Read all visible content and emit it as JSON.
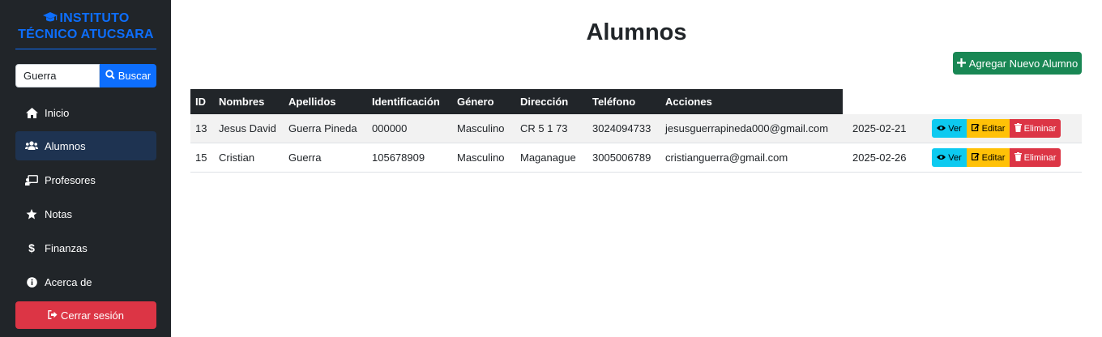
{
  "sidebar": {
    "brand_line1": "INSTITUTO",
    "brand_line2": "TÉCNICO ATUCSARA",
    "search": {
      "value": "Guerra",
      "button_label": "Buscar"
    },
    "items": [
      {
        "label": "Inicio",
        "icon": "home-icon"
      },
      {
        "label": "Alumnos",
        "icon": "users-icon",
        "active": true
      },
      {
        "label": "Profesores",
        "icon": "chalkboard-teacher-icon"
      },
      {
        "label": "Notas",
        "icon": "star-icon"
      },
      {
        "label": "Finanzas",
        "icon": "dollar-icon"
      },
      {
        "label": "Acerca de",
        "icon": "info-circle-icon"
      }
    ],
    "logout_label": "Cerrar sesión"
  },
  "main": {
    "title": "Alumnos",
    "add_button_label": "Agregar Nuevo Alumno",
    "table": {
      "headers": [
        "ID",
        "Nombres",
        "Apellidos",
        "Identificación",
        "Género",
        "Dirección",
        "Teléfono",
        "Acciones"
      ],
      "rows": [
        {
          "id": "13",
          "nombres": "Jesus David",
          "apellidos": "Guerra Pineda",
          "identificacion": "000000",
          "genero": "Masculino",
          "direccion": "CR 5 1 73",
          "telefono": "3024094733",
          "email": "jesusguerrapineda000@gmail.com",
          "fecha": "2025-02-21"
        },
        {
          "id": "15",
          "nombres": "Cristian",
          "apellidos": "Guerra",
          "identificacion": "105678909",
          "genero": "Masculino",
          "direccion": "Maganague",
          "telefono": "3005006789",
          "email": "cristianguerra@gmail.com",
          "fecha": "2025-02-26"
        }
      ],
      "actions": {
        "view": "Ver",
        "edit": "Editar",
        "delete": "Eliminar"
      }
    }
  },
  "colors": {
    "sidebar_bg": "#212529",
    "brand": "#0d6efd",
    "active_item": "#1e3351",
    "danger": "#dc3545",
    "success": "#198754",
    "info": "#0dcaf0",
    "warning": "#ffc107"
  }
}
